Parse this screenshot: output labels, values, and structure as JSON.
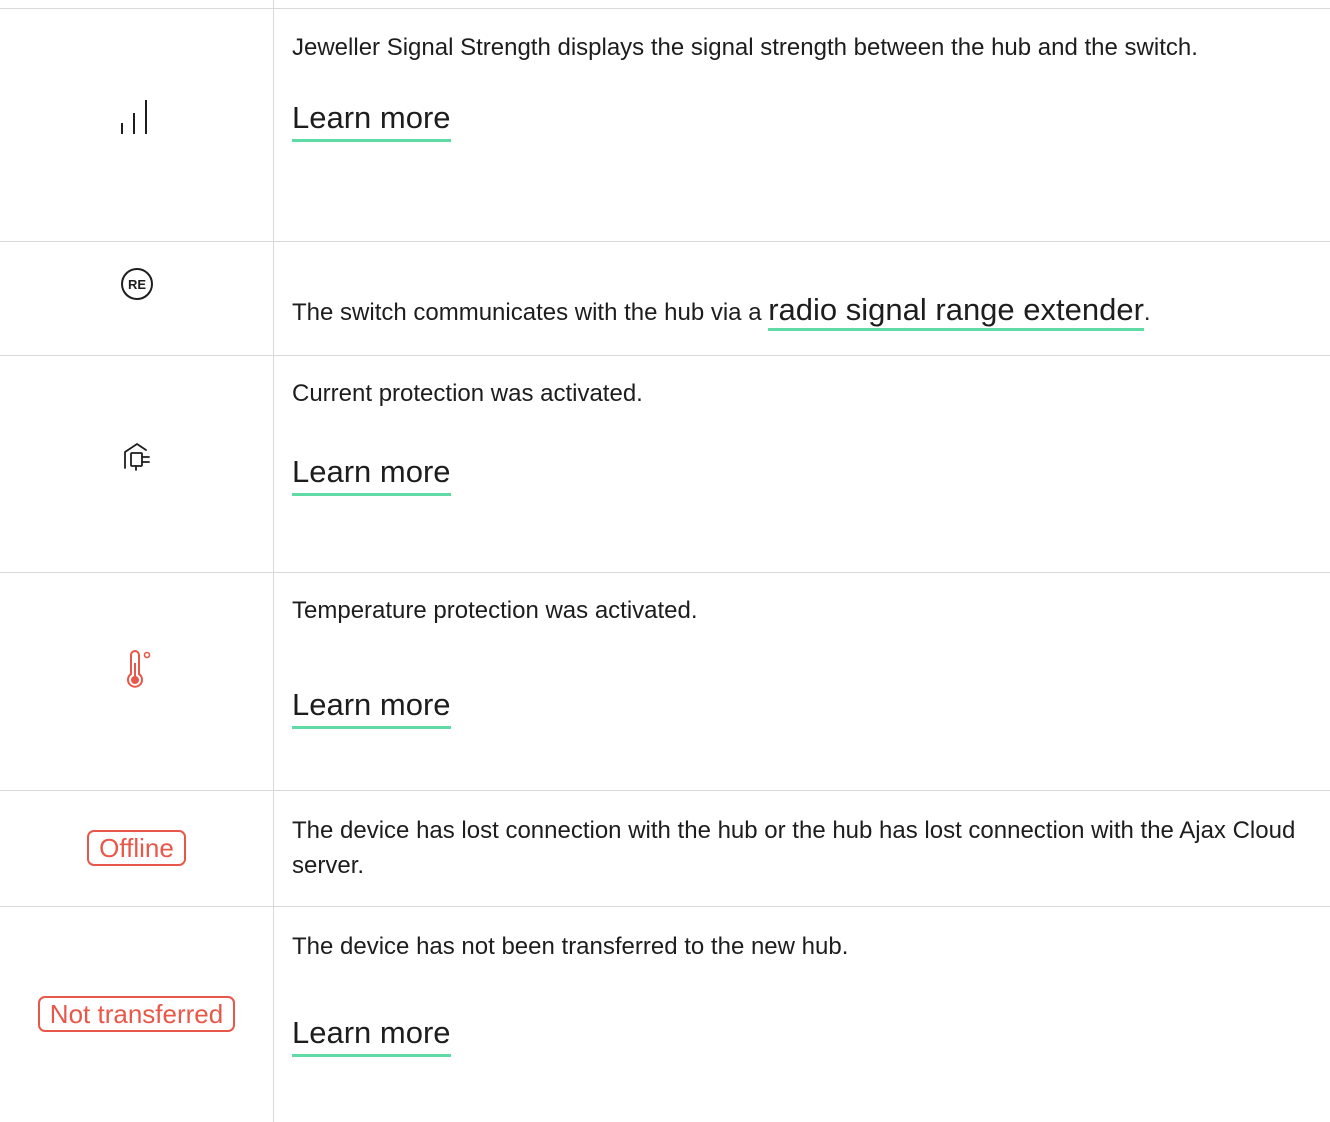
{
  "colors": {
    "accent_underline": "#5fdba6",
    "alert_red": "#e8584a",
    "border": "#d9d9d9",
    "text": "#1d1d1d"
  },
  "rows": [
    {
      "icon": "signal-strength-icon",
      "description": "Jeweller Signal Strength displays the signal strength between the hub and the switch.",
      "link_label": "Learn more"
    },
    {
      "icon": "range-extender-re-icon",
      "icon_text": "RE",
      "description_prefix": "The switch communicates with the hub via a ",
      "description_link": "radio signal range extender",
      "description_suffix": "."
    },
    {
      "icon": "current-protection-icon",
      "description": "Current protection was activated.",
      "link_label": "Learn more"
    },
    {
      "icon": "thermometer-icon",
      "description": "Temperature protection was activated.",
      "link_label": "Learn more"
    },
    {
      "badge": "Offline",
      "description": "The device has lost connection with the hub or the hub has lost connection with the Ajax Cloud server."
    },
    {
      "badge": "Not transferred",
      "description": "The device has not been transferred to the new hub.",
      "link_label": "Learn more"
    }
  ]
}
